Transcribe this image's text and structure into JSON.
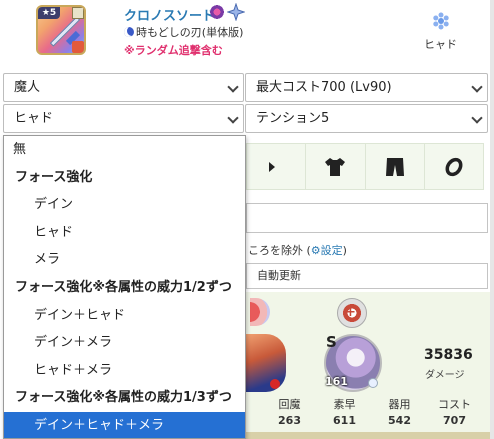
{
  "header": {
    "weapon_star": "★5",
    "weapon_name": "クロノスソード",
    "weapon_sub": "時もどしの刃(単体版)",
    "random_note": "※ランダム追撃含む",
    "tension_label": "ヒャド"
  },
  "selects": {
    "race": "魔人",
    "cost": "最大コスト700 (Lv90)",
    "force": "ヒャド",
    "tension": "テンション5"
  },
  "dropdown": {
    "items": [
      {
        "label": "無",
        "kind": "root"
      },
      {
        "label": "フォース強化",
        "kind": "group"
      },
      {
        "label": "デイン",
        "kind": "opt"
      },
      {
        "label": "ヒャド",
        "kind": "opt"
      },
      {
        "label": "メラ",
        "kind": "opt"
      },
      {
        "label": "フォース強化※各属性の威力1/2ずつ",
        "kind": "group"
      },
      {
        "label": "デイン＋ヒャド",
        "kind": "opt"
      },
      {
        "label": "デイン＋メラ",
        "kind": "opt"
      },
      {
        "label": "ヒャド＋メラ",
        "kind": "opt"
      },
      {
        "label": "フォース強化※各属性の威力1/3ずつ",
        "kind": "group"
      },
      {
        "label": "デイン＋ヒャド＋メラ",
        "kind": "opt",
        "selected": true
      }
    ]
  },
  "equipment": {
    "slot_icons": [
      "accessory-icon",
      "shirt-icon",
      "pants-icon",
      "ring-icon"
    ]
  },
  "search": {
    "exclude_text": "ころを除外",
    "settings_link": "設定",
    "auto_update": "自動更新"
  },
  "result": {
    "char_rank": "S",
    "char_level": "161",
    "damage": "35836",
    "damage_label": "ダメージ",
    "stats": [
      {
        "label": "回魔",
        "value": "263"
      },
      {
        "label": "素早",
        "value": "611"
      },
      {
        "label": "器用",
        "value": "542"
      },
      {
        "label": "コスト",
        "value": "707"
      }
    ]
  },
  "colors": {
    "accent": "#2a7ab3",
    "note": "#e0306e",
    "selected": "#2570d3"
  }
}
